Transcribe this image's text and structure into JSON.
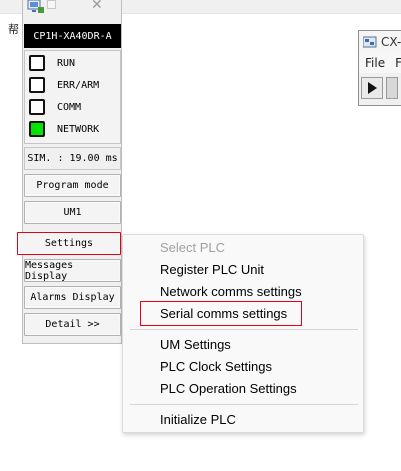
{
  "background": {
    "partial_text": "帮"
  },
  "cx_window": {
    "title": "CX-",
    "menu": [
      "File",
      "F"
    ],
    "logo_icon": "cx-logo-icon",
    "play_icon": "play-icon"
  },
  "plc_panel": {
    "model": "CP1H-XA40DR-A",
    "leds": [
      {
        "label": "RUN",
        "state": "off"
      },
      {
        "label": "ERR/ARM",
        "state": "off"
      },
      {
        "label": "COMM",
        "state": "off"
      },
      {
        "label": "NETWORK",
        "state": "on"
      }
    ],
    "sim_time": "SIM. : 19.00 ms",
    "mode_button": "Program mode",
    "um_button": "UM1",
    "settings_button": "Settings",
    "messages_button": "Messages Display",
    "alarms_button": "Alarms Display",
    "detail_button": "Detail >>"
  },
  "context_menu": {
    "items": [
      {
        "label": "Select PLC",
        "disabled": true
      },
      {
        "label": "Register PLC Unit",
        "disabled": false
      },
      {
        "label": "Network comms settings",
        "disabled": false
      },
      {
        "label": "Serial comms settings",
        "disabled": false
      },
      {
        "label": "UM Settings",
        "disabled": false
      },
      {
        "label": "PLC Clock Settings",
        "disabled": false
      },
      {
        "label": "PLC Operation Settings",
        "disabled": false
      },
      {
        "label": "Initialize PLC",
        "disabled": false
      }
    ]
  },
  "colors": {
    "led_on": "#00e400",
    "highlight": "#e60012",
    "model_bar": "#000000"
  }
}
